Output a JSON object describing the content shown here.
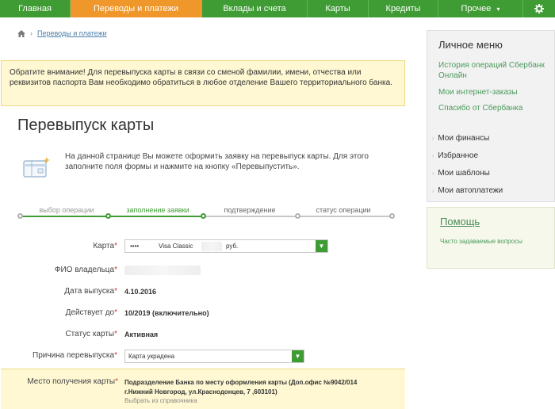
{
  "nav": {
    "items": [
      {
        "label": "Главная"
      },
      {
        "label": "Переводы и платежи"
      },
      {
        "label": "Вклады и счета"
      },
      {
        "label": "Карты"
      },
      {
        "label": "Кредиты"
      },
      {
        "label": "Прочее"
      }
    ],
    "active_index": 1,
    "more_arrow": "▾",
    "settings_icon": "gear-icon"
  },
  "breadcrumb": {
    "home_icon": "home-icon",
    "separator": "›",
    "link": "Переводы и платежи"
  },
  "notice": {
    "text": "Обратите внимание! Для перевыпуска карты в связи со сменой фамилии, имени, отчества или реквизитов паспорта Вам необходимо обратиться в любое отделение Вашего территориального банка."
  },
  "page": {
    "title": "Перевыпуск карты",
    "intro": "На данной странице Вы можете оформить заявку на перевыпуск карты. Для этого заполните поля формы и нажмите на кнопку «Перевыпустить»."
  },
  "steps": [
    {
      "label": "выбор операции",
      "state": "done"
    },
    {
      "label": "заполнение заявки",
      "state": "active"
    },
    {
      "label": "подтверждение",
      "state": "pending"
    },
    {
      "label": "статус операции",
      "state": "pending"
    }
  ],
  "form": {
    "card": {
      "label": "Карта",
      "mask": "••••",
      "name": "Visa Classic",
      "currency": "руб."
    },
    "owner": {
      "label": "ФИО владельца",
      "value": ""
    },
    "issue_date": {
      "label": "Дата выпуска",
      "value": "4.10.2016"
    },
    "valid_until": {
      "label": "Действует до",
      "value": "10/2019 (включительно)"
    },
    "status": {
      "label": "Статус карты",
      "value": "Активная"
    },
    "reason": {
      "label": "Причина перевыпуска",
      "value": "Карта украдена"
    },
    "delivery": {
      "label": "Место получения карты",
      "value_line1": "Подразделение Банка по месту оформления карты (Доп.офис №9042/014",
      "value_line2": "г.Нижний Новгород, ул.Краснодонцев, 7 ,603101)",
      "link": "Выбрать из справочника"
    },
    "required_mark": "*",
    "dropdown_arrow": "▼"
  },
  "sidebar": {
    "title": "Личное меню",
    "links": [
      "История операций Сбербанк Онлайн",
      "Мои интернет-заказы",
      "Спасибо от Сбербанка"
    ],
    "items": [
      "Мои финансы",
      "Избранное",
      "Мои шаблоны",
      "Мои автоплатежи"
    ],
    "bullet": "›"
  },
  "help": {
    "title": "Помощь",
    "link": "Часто задаваемые вопросы"
  },
  "colors": {
    "brand_green": "#3f9c35",
    "active_orange": "#f0972c",
    "notice_bg": "#fff8d3"
  }
}
